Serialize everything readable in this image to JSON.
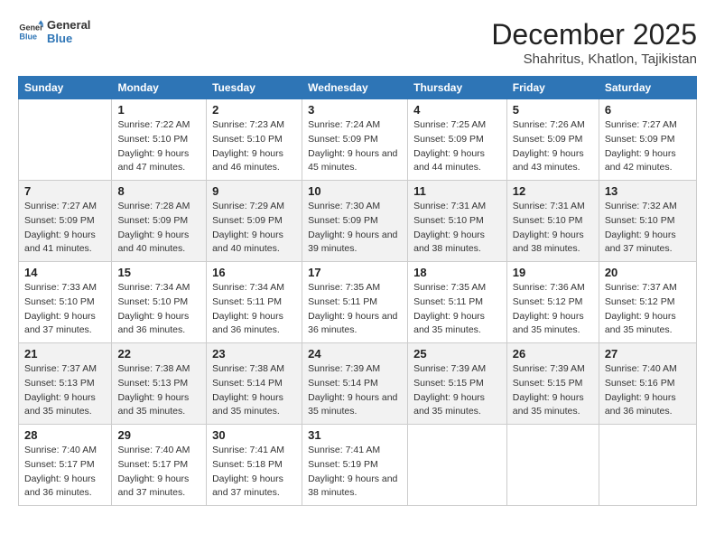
{
  "logo": {
    "line1": "General",
    "line2": "Blue"
  },
  "title": "December 2025",
  "location": "Shahritus, Khatlon, Tajikistan",
  "weekdays": [
    "Sunday",
    "Monday",
    "Tuesday",
    "Wednesday",
    "Thursday",
    "Friday",
    "Saturday"
  ],
  "weeks": [
    [
      {
        "day": "",
        "sunrise": "",
        "sunset": "",
        "daylight": ""
      },
      {
        "day": "1",
        "sunrise": "Sunrise: 7:22 AM",
        "sunset": "Sunset: 5:10 PM",
        "daylight": "Daylight: 9 hours and 47 minutes."
      },
      {
        "day": "2",
        "sunrise": "Sunrise: 7:23 AM",
        "sunset": "Sunset: 5:10 PM",
        "daylight": "Daylight: 9 hours and 46 minutes."
      },
      {
        "day": "3",
        "sunrise": "Sunrise: 7:24 AM",
        "sunset": "Sunset: 5:09 PM",
        "daylight": "Daylight: 9 hours and 45 minutes."
      },
      {
        "day": "4",
        "sunrise": "Sunrise: 7:25 AM",
        "sunset": "Sunset: 5:09 PM",
        "daylight": "Daylight: 9 hours and 44 minutes."
      },
      {
        "day": "5",
        "sunrise": "Sunrise: 7:26 AM",
        "sunset": "Sunset: 5:09 PM",
        "daylight": "Daylight: 9 hours and 43 minutes."
      },
      {
        "day": "6",
        "sunrise": "Sunrise: 7:27 AM",
        "sunset": "Sunset: 5:09 PM",
        "daylight": "Daylight: 9 hours and 42 minutes."
      }
    ],
    [
      {
        "day": "7",
        "sunrise": "Sunrise: 7:27 AM",
        "sunset": "Sunset: 5:09 PM",
        "daylight": "Daylight: 9 hours and 41 minutes."
      },
      {
        "day": "8",
        "sunrise": "Sunrise: 7:28 AM",
        "sunset": "Sunset: 5:09 PM",
        "daylight": "Daylight: 9 hours and 40 minutes."
      },
      {
        "day": "9",
        "sunrise": "Sunrise: 7:29 AM",
        "sunset": "Sunset: 5:09 PM",
        "daylight": "Daylight: 9 hours and 40 minutes."
      },
      {
        "day": "10",
        "sunrise": "Sunrise: 7:30 AM",
        "sunset": "Sunset: 5:09 PM",
        "daylight": "Daylight: 9 hours and 39 minutes."
      },
      {
        "day": "11",
        "sunrise": "Sunrise: 7:31 AM",
        "sunset": "Sunset: 5:10 PM",
        "daylight": "Daylight: 9 hours and 38 minutes."
      },
      {
        "day": "12",
        "sunrise": "Sunrise: 7:31 AM",
        "sunset": "Sunset: 5:10 PM",
        "daylight": "Daylight: 9 hours and 38 minutes."
      },
      {
        "day": "13",
        "sunrise": "Sunrise: 7:32 AM",
        "sunset": "Sunset: 5:10 PM",
        "daylight": "Daylight: 9 hours and 37 minutes."
      }
    ],
    [
      {
        "day": "14",
        "sunrise": "Sunrise: 7:33 AM",
        "sunset": "Sunset: 5:10 PM",
        "daylight": "Daylight: 9 hours and 37 minutes."
      },
      {
        "day": "15",
        "sunrise": "Sunrise: 7:34 AM",
        "sunset": "Sunset: 5:10 PM",
        "daylight": "Daylight: 9 hours and 36 minutes."
      },
      {
        "day": "16",
        "sunrise": "Sunrise: 7:34 AM",
        "sunset": "Sunset: 5:11 PM",
        "daylight": "Daylight: 9 hours and 36 minutes."
      },
      {
        "day": "17",
        "sunrise": "Sunrise: 7:35 AM",
        "sunset": "Sunset: 5:11 PM",
        "daylight": "Daylight: 9 hours and 36 minutes."
      },
      {
        "day": "18",
        "sunrise": "Sunrise: 7:35 AM",
        "sunset": "Sunset: 5:11 PM",
        "daylight": "Daylight: 9 hours and 35 minutes."
      },
      {
        "day": "19",
        "sunrise": "Sunrise: 7:36 AM",
        "sunset": "Sunset: 5:12 PM",
        "daylight": "Daylight: 9 hours and 35 minutes."
      },
      {
        "day": "20",
        "sunrise": "Sunrise: 7:37 AM",
        "sunset": "Sunset: 5:12 PM",
        "daylight": "Daylight: 9 hours and 35 minutes."
      }
    ],
    [
      {
        "day": "21",
        "sunrise": "Sunrise: 7:37 AM",
        "sunset": "Sunset: 5:13 PM",
        "daylight": "Daylight: 9 hours and 35 minutes."
      },
      {
        "day": "22",
        "sunrise": "Sunrise: 7:38 AM",
        "sunset": "Sunset: 5:13 PM",
        "daylight": "Daylight: 9 hours and 35 minutes."
      },
      {
        "day": "23",
        "sunrise": "Sunrise: 7:38 AM",
        "sunset": "Sunset: 5:14 PM",
        "daylight": "Daylight: 9 hours and 35 minutes."
      },
      {
        "day": "24",
        "sunrise": "Sunrise: 7:39 AM",
        "sunset": "Sunset: 5:14 PM",
        "daylight": "Daylight: 9 hours and 35 minutes."
      },
      {
        "day": "25",
        "sunrise": "Sunrise: 7:39 AM",
        "sunset": "Sunset: 5:15 PM",
        "daylight": "Daylight: 9 hours and 35 minutes."
      },
      {
        "day": "26",
        "sunrise": "Sunrise: 7:39 AM",
        "sunset": "Sunset: 5:15 PM",
        "daylight": "Daylight: 9 hours and 35 minutes."
      },
      {
        "day": "27",
        "sunrise": "Sunrise: 7:40 AM",
        "sunset": "Sunset: 5:16 PM",
        "daylight": "Daylight: 9 hours and 36 minutes."
      }
    ],
    [
      {
        "day": "28",
        "sunrise": "Sunrise: 7:40 AM",
        "sunset": "Sunset: 5:17 PM",
        "daylight": "Daylight: 9 hours and 36 minutes."
      },
      {
        "day": "29",
        "sunrise": "Sunrise: 7:40 AM",
        "sunset": "Sunset: 5:17 PM",
        "daylight": "Daylight: 9 hours and 37 minutes."
      },
      {
        "day": "30",
        "sunrise": "Sunrise: 7:41 AM",
        "sunset": "Sunset: 5:18 PM",
        "daylight": "Daylight: 9 hours and 37 minutes."
      },
      {
        "day": "31",
        "sunrise": "Sunrise: 7:41 AM",
        "sunset": "Sunset: 5:19 PM",
        "daylight": "Daylight: 9 hours and 38 minutes."
      },
      {
        "day": "",
        "sunrise": "",
        "sunset": "",
        "daylight": ""
      },
      {
        "day": "",
        "sunrise": "",
        "sunset": "",
        "daylight": ""
      },
      {
        "day": "",
        "sunrise": "",
        "sunset": "",
        "daylight": ""
      }
    ]
  ]
}
